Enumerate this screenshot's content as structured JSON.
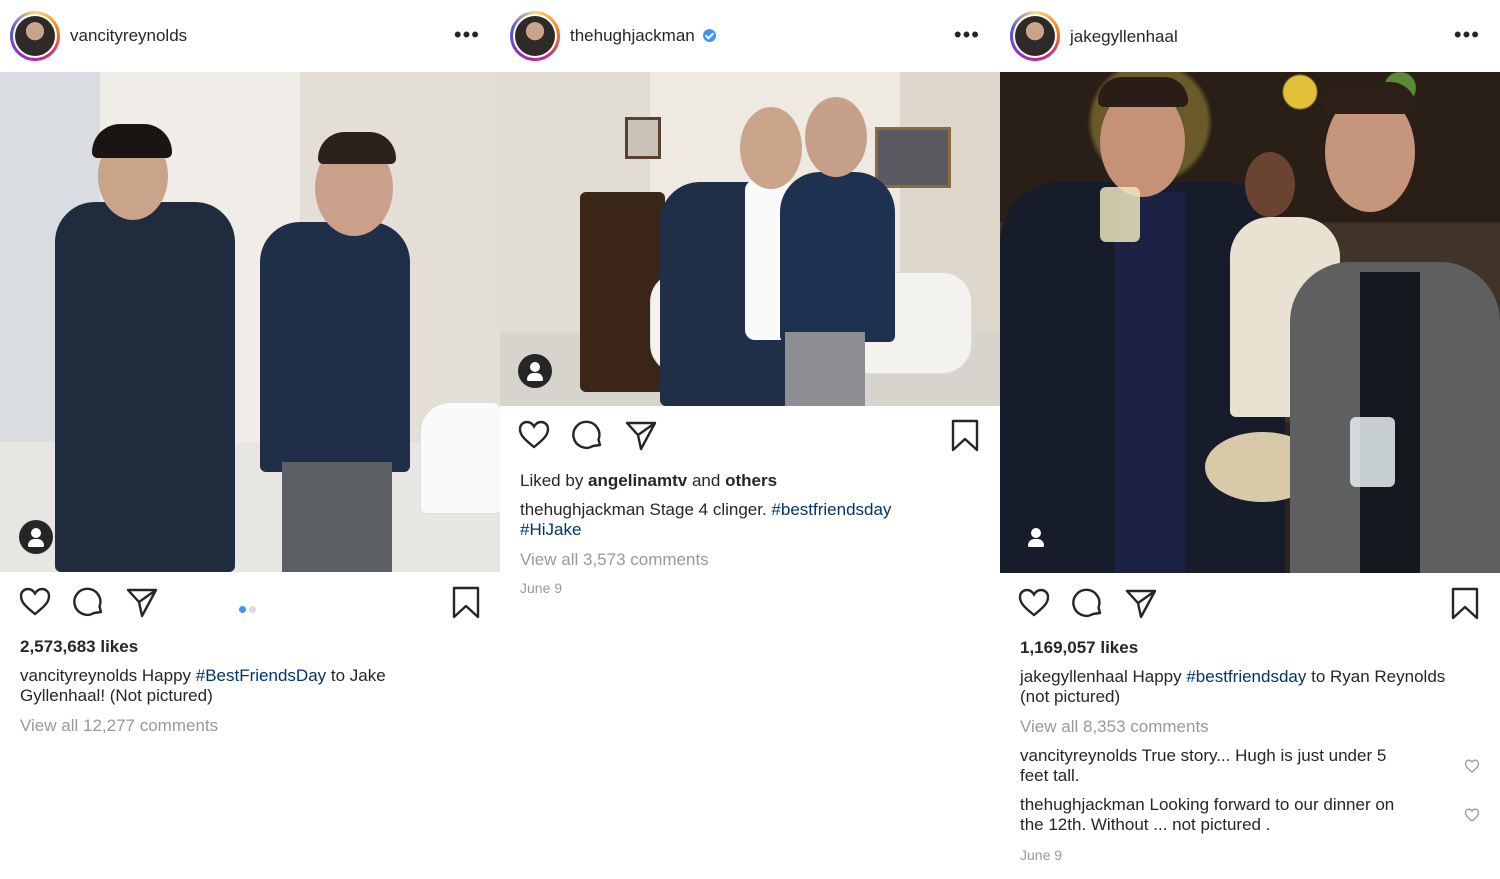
{
  "colors": {
    "accent": "#3897f0",
    "hashtag": "#003569",
    "muted": "#999999",
    "text": "#262626"
  },
  "posts": [
    {
      "username": "vancityreynolds",
      "verified": false,
      "likes": "2,573,683 likes",
      "caption_user": "vancityreynolds",
      "caption_pre": " Happy ",
      "caption_tag": "#BestFriendsDay",
      "caption_post": " to Jake",
      "caption_line2": "Gyllenhaal! (Not pictured)",
      "view_comments": "View all 12,277 comments",
      "carousel_dots": 2,
      "icons": [
        "heart-icon",
        "comment-icon",
        "share-icon",
        "bookmark-icon"
      ]
    },
    {
      "username": "thehughjackman",
      "verified": true,
      "liked_by_pre": "Liked by ",
      "liked_by_user": "angelinamtv",
      "liked_by_post": " and ",
      "liked_by_others": "others",
      "caption_user": "thehughjackman",
      "caption_text": " Stage 4 clinger. ",
      "caption_tag": "#bestfriendsday",
      "caption_tag2": "#HiJake",
      "view_comments": "View all 3,573 comments",
      "date": "June 9",
      "icons": [
        "heart-icon",
        "comment-icon",
        "share-icon",
        "bookmark-icon"
      ]
    },
    {
      "username": "jakegyllenhaal",
      "verified": false,
      "likes": "1,169,057 likes",
      "caption_user": "jakegyllenhaal",
      "caption_pre": " Happy ",
      "caption_tag": "#bestfriendsday",
      "caption_post": " to Ryan Reynolds",
      "caption_line2": "(not pictured)",
      "view_comments": "View all 8,353 comments",
      "comments": [
        {
          "user": "vancityreynolds",
          "text1": " True story... Hugh is just under 5",
          "text2": "feet tall."
        },
        {
          "user": "thehughjackman",
          "text1": " Looking forward to our dinner on",
          "text2": "the 12th. Without ... not pictured ."
        }
      ],
      "date": "June 9",
      "icons": [
        "heart-icon",
        "comment-icon",
        "share-icon",
        "bookmark-icon"
      ]
    }
  ]
}
